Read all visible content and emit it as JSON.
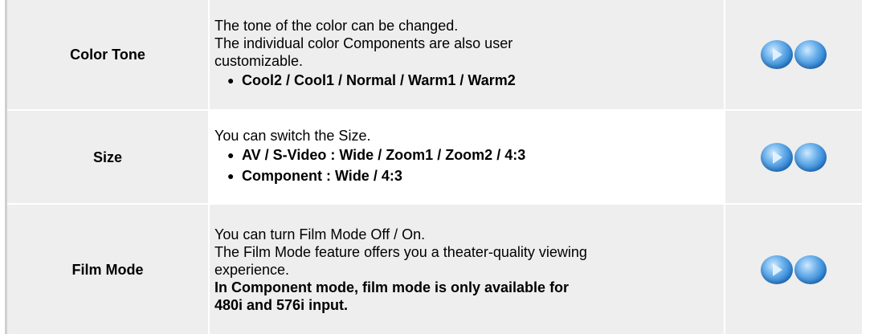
{
  "rows": [
    {
      "label": "Color Tone",
      "desc_lines": [
        "The tone of the color can be changed.",
        "The individual color Components are also user customizable."
      ],
      "bullets": [
        "Cool2 / Cool1 / Normal / Warm1 / Warm2"
      ],
      "controls": [
        "play-icon",
        "sphere-icon"
      ]
    },
    {
      "label": "Size",
      "desc_lines": [
        "You can switch the Size."
      ],
      "bullets": [
        "AV / S-Video : Wide / Zoom1 / Zoom2 / 4:3",
        "Component : Wide / 4:3"
      ],
      "controls": [
        "play-icon",
        "sphere-icon"
      ]
    },
    {
      "label": "Film Mode",
      "desc_lines": [
        "You can turn Film Mode Off / On.",
        "The Film Mode feature offers you a theater-quality viewing experience."
      ],
      "note": "In Component mode, film mode is only available for 480i and 576i input.",
      "controls": [
        "play-icon",
        "sphere-icon"
      ]
    }
  ],
  "colors": {
    "row_shade": "#eeeeee",
    "orb_blue": "#2a7fd0"
  }
}
